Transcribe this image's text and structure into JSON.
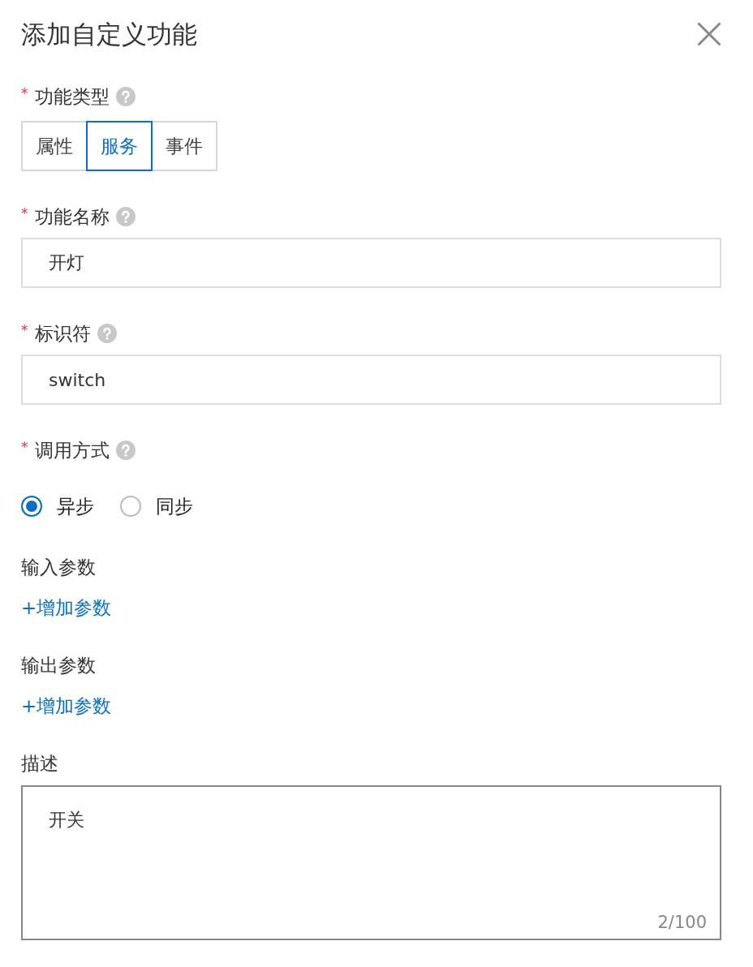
{
  "dialog": {
    "title": "添加自定义功能"
  },
  "fields": [
    {
      "kind": "segmented",
      "required_mark": "*",
      "label": "功能类型",
      "help": true,
      "options": [
        {
          "label": "属性",
          "selected": false
        },
        {
          "label": "服务",
          "selected": true
        },
        {
          "label": "事件",
          "selected": false
        }
      ]
    },
    {
      "kind": "input",
      "required_mark": "*",
      "label": "功能名称",
      "help": true,
      "value": "开灯"
    },
    {
      "kind": "input",
      "required_mark": "*",
      "label": "标识符",
      "help": true,
      "value": "switch"
    },
    {
      "kind": "radio",
      "required_mark": "*",
      "label": "调用方式",
      "help": true,
      "options": [
        {
          "label": "异步",
          "selected": true
        },
        {
          "label": "同步",
          "selected": false
        }
      ]
    },
    {
      "kind": "params",
      "label": "输入参数",
      "help": false,
      "link": "+增加参数"
    },
    {
      "kind": "params",
      "label": "输出参数",
      "help": false,
      "link": "+增加参数"
    },
    {
      "kind": "textarea",
      "label": "描述",
      "help": false,
      "value": "开关",
      "counter": "2/100"
    }
  ]
}
